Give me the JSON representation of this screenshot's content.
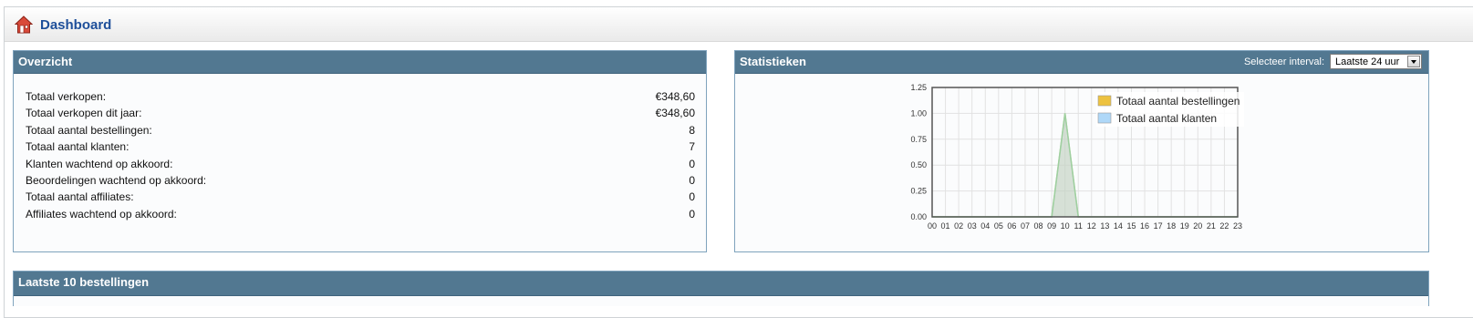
{
  "header": {
    "title": "Dashboard",
    "icon": "home-icon"
  },
  "overview": {
    "title": "Overzicht",
    "rows": [
      {
        "label": "Totaal verkopen:",
        "value": "€348,60"
      },
      {
        "label": "Totaal verkopen dit jaar:",
        "value": "€348,60"
      },
      {
        "label": "Totaal aantal bestellingen:",
        "value": "8"
      },
      {
        "label": "Totaal aantal klanten:",
        "value": "7"
      },
      {
        "label": "Klanten wachtend op akkoord:",
        "value": "0"
      },
      {
        "label": "Beoordelingen wachtend op akkoord:",
        "value": "0"
      },
      {
        "label": "Totaal aantal affiliates:",
        "value": "0"
      },
      {
        "label": "Affiliates wachtend op akkoord:",
        "value": "0"
      }
    ]
  },
  "stats": {
    "title": "Statistieken",
    "interval_label": "Selecteer interval:",
    "interval_value": "Laatste 24 uur"
  },
  "orders": {
    "title": "Laatste 10 bestellingen"
  },
  "chart_data": {
    "type": "area",
    "x": [
      "00",
      "01",
      "02",
      "03",
      "04",
      "05",
      "06",
      "07",
      "08",
      "09",
      "10",
      "11",
      "12",
      "13",
      "14",
      "15",
      "16",
      "17",
      "18",
      "19",
      "20",
      "21",
      "22",
      "23"
    ],
    "series": [
      {
        "name": "Totaal aantal bestellingen",
        "color": "#edc240",
        "values": [
          0,
          0,
          0,
          0,
          0,
          0,
          0,
          0,
          0,
          0,
          1,
          0,
          0,
          0,
          0,
          0,
          0,
          0,
          0,
          0,
          0,
          0,
          0,
          0
        ]
      },
      {
        "name": "Totaal aantal klanten",
        "color": "#afd8f8",
        "values": [
          0,
          0,
          0,
          0,
          0,
          0,
          0,
          0,
          0,
          0,
          1,
          0,
          0,
          0,
          0,
          0,
          0,
          0,
          0,
          0,
          0,
          0,
          0,
          0
        ]
      }
    ],
    "ylim": [
      0,
      1.25
    ],
    "yticks": [
      "0.00",
      "0.25",
      "0.50",
      "0.75",
      "1.00",
      "1.25"
    ],
    "grid": true,
    "legend_position": "top-right"
  }
}
